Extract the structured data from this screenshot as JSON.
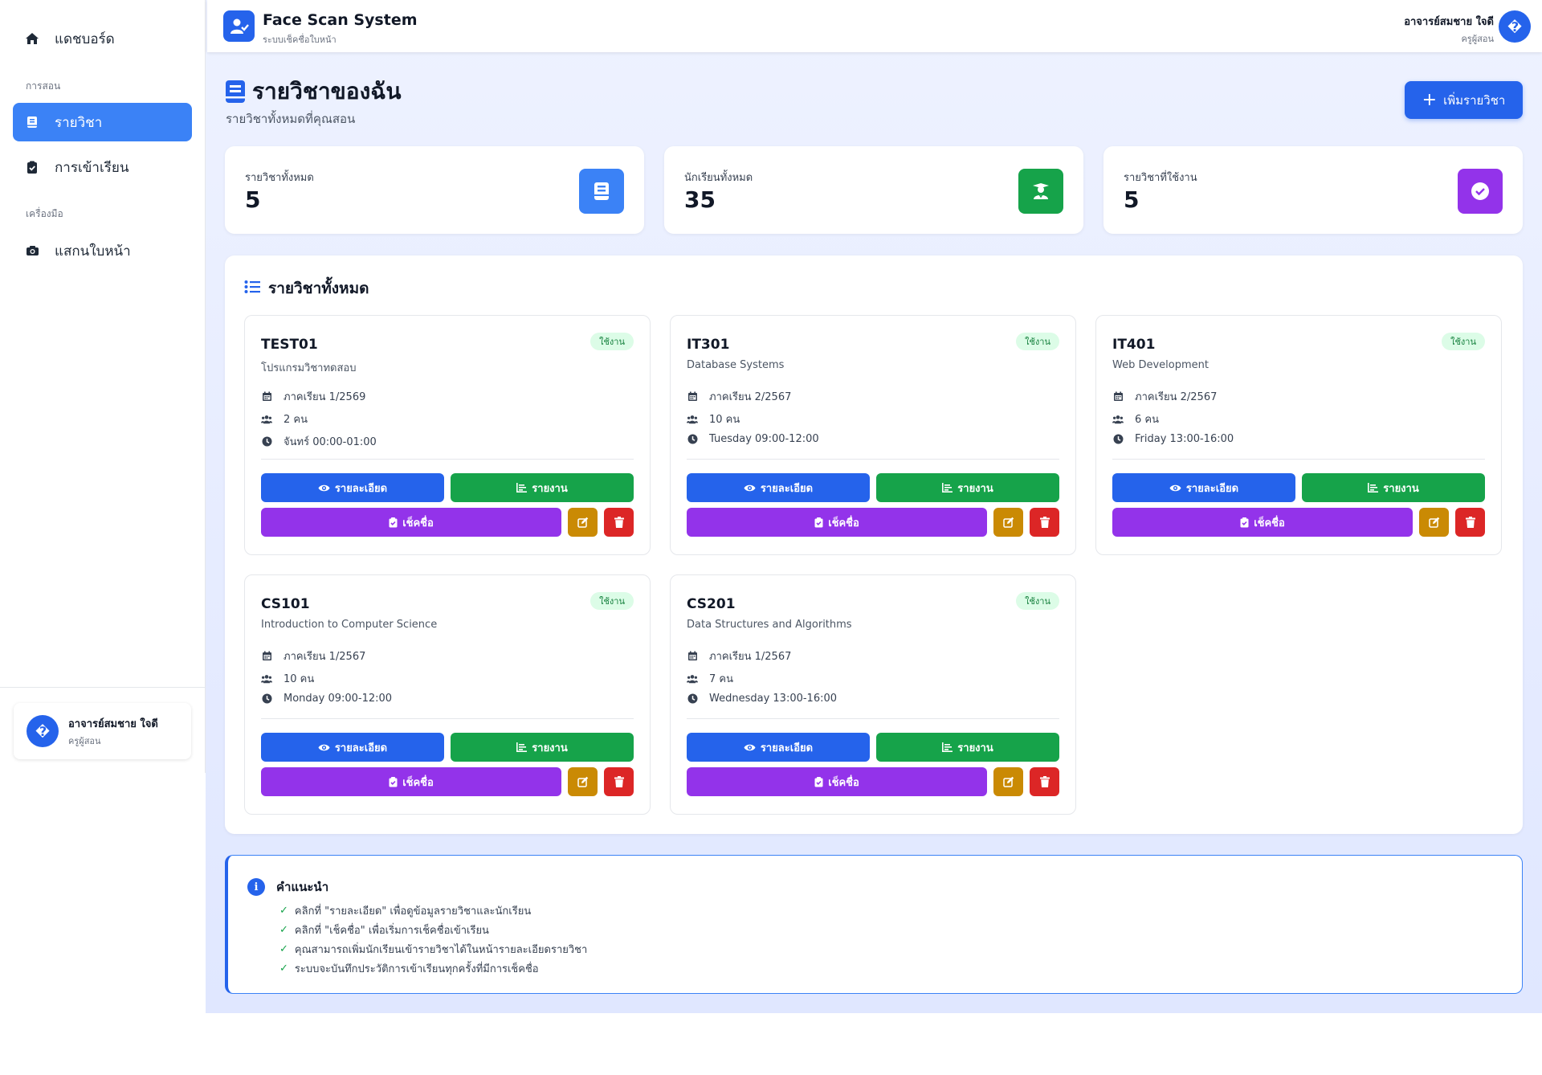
{
  "sidebar": {
    "dashboard": "แดชบอร์ด",
    "section_teaching": "การสอน",
    "courses": "รายวิชา",
    "attendance": "การเข้าเรียน",
    "section_tools": "เครื่องมือ",
    "face_scan": "แสกนใบหน้า",
    "user_name": "อาจารย์สมชาย ใจดี",
    "user_role": "ครูผู้สอน",
    "avatar_glyph": "�"
  },
  "header": {
    "app_title": "Face Scan System",
    "app_subtitle": "ระบบเช็คชื่อใบหน้า",
    "user_name": "อาจารย์สมชาย ใจดี",
    "user_role": "ครูผู้สอน",
    "avatar_glyph": "�"
  },
  "page": {
    "title": "รายวิชาของฉัน",
    "subtitle": "รายวิชาทั้งหมดที่คุณสอน",
    "add_button": "เพิ่มรายวิชา"
  },
  "stats": [
    {
      "label": "รายวิชาทั้งหมด",
      "value": "5",
      "icon": "book-icon",
      "color": "#3b82f6"
    },
    {
      "label": "นักเรียนทั้งหมด",
      "value": "35",
      "icon": "graduate-icon",
      "color": "#16a34a"
    },
    {
      "label": "รายวิชาที่ใช้งาน",
      "value": "5",
      "icon": "check-circle-icon",
      "color": "#9333ea"
    }
  ],
  "courses_panel": {
    "title": "รายวิชาทั้งหมด",
    "buttons": {
      "details": "รายละเอียด",
      "report": "รายงาน",
      "checkin": "เช็คชื่อ"
    },
    "courses": [
      {
        "code": "TEST01",
        "name": "โปรแกรมวิชาทดสอบ",
        "status": "ใช้งาน",
        "term": "ภาคเรียน 1/2569",
        "students": "2 คน",
        "schedule": "จันทร์ 00:00-01:00"
      },
      {
        "code": "IT301",
        "name": "Database Systems",
        "status": "ใช้งาน",
        "term": "ภาคเรียน 2/2567",
        "students": "10 คน",
        "schedule": "Tuesday 09:00-12:00"
      },
      {
        "code": "IT401",
        "name": "Web Development",
        "status": "ใช้งาน",
        "term": "ภาคเรียน 2/2567",
        "students": "6 คน",
        "schedule": "Friday 13:00-16:00"
      },
      {
        "code": "CS101",
        "name": "Introduction to Computer Science",
        "status": "ใช้งาน",
        "term": "ภาคเรียน 1/2567",
        "students": "10 คน",
        "schedule": "Monday 09:00-12:00"
      },
      {
        "code": "CS201",
        "name": "Data Structures and Algorithms",
        "status": "ใช้งาน",
        "term": "ภาคเรียน 1/2567",
        "students": "7 คน",
        "schedule": "Wednesday 13:00-16:00"
      }
    ]
  },
  "tips": {
    "title": "คำแนะนำ",
    "items": [
      "คลิกที่ \"รายละเอียด\" เพื่อดูข้อมูลรายวิชาและนักเรียน",
      "คลิกที่ \"เช็คชื่อ\" เพื่อเริ่มการเช็คชื่อเข้าเรียน",
      "คุณสามารถเพิ่มนักเรียนเข้ารายวิชาได้ในหน้ารายละเอียดรายวิชา",
      "ระบบจะบันทึกประวัติการเข้าเรียนทุกครั้งที่มีการเช็คชื่อ"
    ]
  },
  "colors": {
    "primary": "#2563eb",
    "success": "#16a34a",
    "purple": "#9333ea",
    "warning": "#ca8a04",
    "danger": "#dc2626"
  }
}
